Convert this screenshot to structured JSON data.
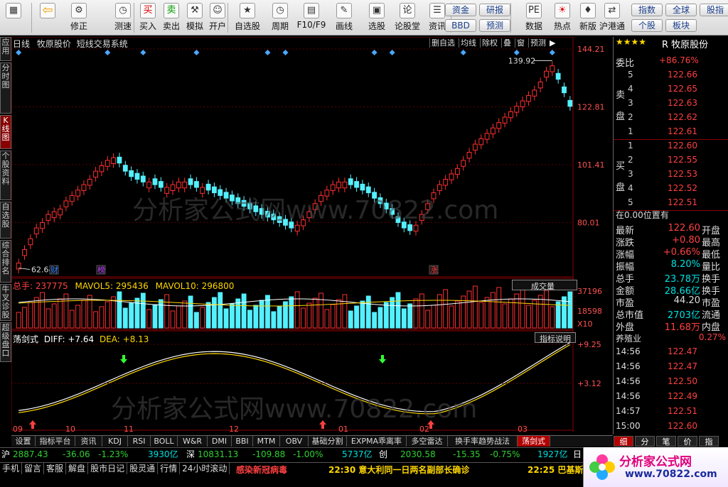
{
  "toolbar": {
    "items": [
      {
        "label": "",
        "icon": "grid-icon"
      },
      {
        "label": "",
        "icon": "back-arrow-icon"
      },
      {
        "label": "修正",
        "icon": "repair-icon"
      },
      {
        "label": "测速",
        "icon": "clock-icon"
      },
      {
        "label": "买入",
        "icon": "buy-icon",
        "glyph": "买"
      },
      {
        "label": "卖出",
        "icon": "sell-icon",
        "glyph": "卖"
      },
      {
        "label": "模拟",
        "icon": "hammer-icon"
      },
      {
        "label": "开户",
        "icon": "user-icon"
      },
      {
        "label": "自选股",
        "icon": "star-icon"
      },
      {
        "label": "周期",
        "icon": "clock-icon"
      },
      {
        "label": "F10/F9",
        "icon": "doc-icon"
      },
      {
        "label": "画线",
        "icon": "pen-icon"
      },
      {
        "label": "选股",
        "icon": "screen-icon"
      },
      {
        "label": "论股堂",
        "icon": "forum-icon",
        "glyph": "论"
      },
      {
        "label": "资讯",
        "icon": "news-icon"
      },
      {
        "label": "数据",
        "icon": "data-icon"
      },
      {
        "label": "热点",
        "icon": "hot-icon"
      },
      {
        "label": "新版",
        "icon": "new-icon"
      },
      {
        "label": "沪港通",
        "icon": "hk-icon"
      }
    ],
    "pills": [
      "资金",
      "研报",
      "BBD",
      "预测",
      "指数",
      "全球",
      "股指",
      "个股",
      "板块"
    ]
  },
  "chart_header": {
    "period": "日线",
    "stock": "牧原股价",
    "system": "短线交易系统",
    "buttons": [
      "删自选",
      "均线",
      "除权",
      "叠",
      "窗",
      "预测"
    ]
  },
  "kline": {
    "high_label": "139.92",
    "low_label": "62.64",
    "markers": [
      "财",
      "榜",
      "涨"
    ],
    "price_ticks": [
      "144.21",
      "122.81",
      "101.41",
      "80.01"
    ]
  },
  "volume": {
    "title": "总手: 237775",
    "mavol5": "MAVOL5: 295436",
    "mavol10": "MAVOL10: 296800",
    "dropdown": "成交量",
    "ticks": [
      "37196",
      "18598",
      "X10"
    ]
  },
  "macd": {
    "title": "荡剑式",
    "diff": "DIFF: +7.64",
    "dea": "DEA: +8.13",
    "button": "指标说明",
    "ticks": [
      "+9.25",
      "+3.12"
    ]
  },
  "months": [
    "09",
    "10",
    "11",
    "12",
    "01",
    "02",
    "03"
  ],
  "bottom_tabs": [
    "设置",
    "指标平台",
    "资讯",
    "KDJ",
    "RSI",
    "BOLL",
    "W&R",
    "DMI",
    "BBI",
    "MTM",
    "OBV",
    "基础分割",
    "EXPMA乖离率",
    "多空雷达",
    "换手率趋势战法",
    "荡剑式"
  ],
  "quote": {
    "rating": "★★★★",
    "code": "R 牧原股份",
    "weibi_label": "委比",
    "weibi": "+86.76%",
    "sell_label": "卖盘",
    "buy_label": "买盘",
    "sells": [
      {
        "n": "5",
        "p": "122.66"
      },
      {
        "n": "4",
        "p": "122.65"
      },
      {
        "n": "3",
        "p": "122.63"
      },
      {
        "n": "2",
        "p": "122.62"
      },
      {
        "n": "1",
        "p": "122.61"
      }
    ],
    "buys": [
      {
        "n": "1",
        "p": "122.60"
      },
      {
        "n": "2",
        "p": "122.55"
      },
      {
        "n": "3",
        "p": "122.53"
      },
      {
        "n": "4",
        "p": "122.52"
      },
      {
        "n": "5",
        "p": "122.51"
      }
    ],
    "position": "在0.00位置有",
    "stats": [
      {
        "k": "最新",
        "v": "122.60",
        "k2": "开盘"
      },
      {
        "k": "涨跌",
        "v": "+0.80",
        "k2": "最高"
      },
      {
        "k": "涨幅",
        "v": "+0.66%",
        "k2": "最低"
      },
      {
        "k": "振幅",
        "v": "8.20%",
        "k2": "量比"
      },
      {
        "k": "总手",
        "v": "23.78万",
        "k2": "换手"
      },
      {
        "k": "金额",
        "v": "28.66亿",
        "k2": "换手"
      },
      {
        "k": "市盈",
        "v": "44.20",
        "k2": "市盈"
      },
      {
        "k": "总市值",
        "v": "2703亿",
        "k2": "流通"
      },
      {
        "k": "外盘",
        "v": "11.68万",
        "k2": "内盘"
      }
    ],
    "industry": "养殖业",
    "industry_pct": "0.27%",
    "ticks": [
      {
        "t": "14:56",
        "p": "122.47"
      },
      {
        "t": "14:56",
        "p": "122.47"
      },
      {
        "t": "14:56",
        "p": "122.50"
      },
      {
        "t": "14:56",
        "p": "122.49"
      },
      {
        "t": "14:57",
        "p": "122.51"
      },
      {
        "t": "15:00",
        "p": "122.60"
      }
    ],
    "tabs": [
      "细",
      "分",
      "笔",
      "价",
      "指"
    ]
  },
  "index_bar": {
    "sh_label": "沪",
    "sh": "2887.43",
    "sh_chg": "-36.06",
    "sh_pct": "-1.23%",
    "sh_amt": "3930亿",
    "sz_label": "深",
    "sz": "10831.13",
    "sz_chg": "-109.88",
    "sz_pct": "-1.00%",
    "sz_amt": "5737亿",
    "cy_label": "创",
    "cy": "2030.58",
    "cy_chg": "-15.35",
    "cy_pct": "-0.75%",
    "cy_amt": "1927亿",
    "tail": "日"
  },
  "status_bar": {
    "items": [
      "手机",
      "留言",
      "客服",
      "解盘",
      "股市日记",
      "股灵通",
      "行情",
      "24小时滚动"
    ],
    "news1": "感染新冠病毒",
    "news2": "22:30 意大利同一日两名副部长确诊",
    "news3": "22:25 巴基斯"
  },
  "watermark": "分析家公式网www.70822.com",
  "logo": {
    "text": "分析家公式网",
    "url": "www.70822.com"
  },
  "left_tabs": [
    "应用",
    "分时图",
    "K线图",
    "个股资料",
    "自选股",
    "综合排名",
    "牛叉诊股",
    "超级盘口"
  ],
  "chart_data": [
    {
      "type": "candlestick",
      "title": "牧原股价 日线",
      "x_months": [
        "09",
        "10",
        "11",
        "12",
        "01",
        "02",
        "03"
      ],
      "ylim": [
        62,
        145
      ],
      "annotations": {
        "high": 139.92,
        "low": 62.64
      },
      "values": [
        65,
        70,
        74,
        78,
        80,
        83,
        84,
        85,
        88,
        90,
        92,
        94,
        96,
        99,
        101,
        103,
        104,
        102,
        99,
        97,
        96,
        95,
        95,
        94,
        93,
        93,
        94,
        95,
        95,
        94,
        93,
        93,
        92,
        91,
        90,
        89,
        88,
        87,
        86,
        85,
        84,
        83,
        82,
        81,
        80,
        79,
        78,
        79,
        81,
        84,
        87,
        90,
        92,
        94,
        95,
        95,
        94,
        93,
        92,
        91,
        89,
        87,
        85,
        83,
        80,
        78,
        77,
        79,
        83,
        87,
        91,
        94,
        96,
        98,
        100,
        103,
        106,
        109,
        111,
        113,
        115,
        117,
        119,
        121,
        123,
        125,
        127,
        129,
        132,
        136,
        138,
        133,
        128,
        123
      ]
    },
    {
      "type": "bar",
      "title": "成交量",
      "series": [
        {
          "name": "MAVOL5",
          "value": 295436
        },
        {
          "name": "MAVOL10",
          "value": 296800
        }
      ],
      "ylim": [
        0,
        37196
      ]
    },
    {
      "type": "line",
      "title": "荡剑式",
      "series": [
        {
          "name": "DIFF",
          "last": 7.64
        },
        {
          "name": "DEA",
          "last": 8.13
        }
      ],
      "ylim": [
        -1,
        9.25
      ]
    }
  ]
}
